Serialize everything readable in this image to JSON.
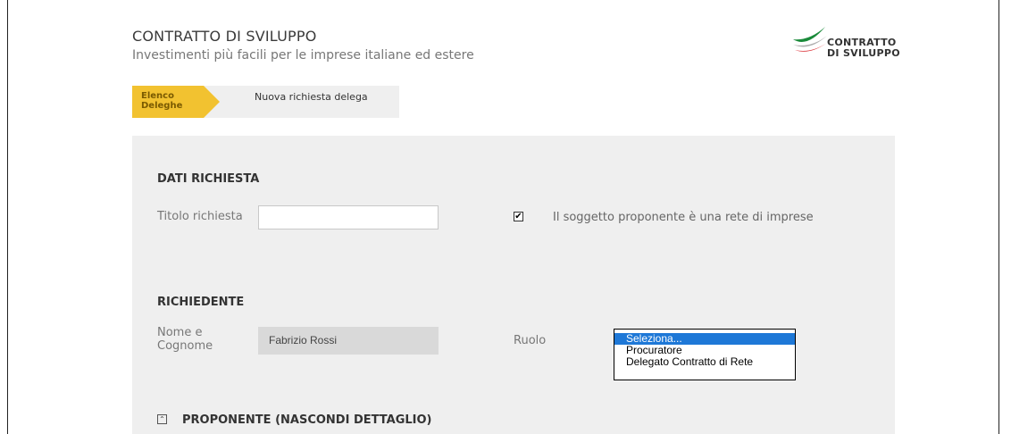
{
  "header": {
    "title": "CONTRATTO DI SVILUPPO",
    "subtitle": "Investimenti più facili per le imprese italiane ed estere",
    "logo_line1": "CONTRATTO",
    "logo_line2": "DI SVILUPPO"
  },
  "breadcrumb": {
    "active_line1": "Elenco",
    "active_line2": "Deleghe",
    "next": "Nuova richiesta delega"
  },
  "dati_richiesta": {
    "section_title": "DATI RICHIESTA",
    "titolo_label": "Titolo richiesta",
    "titolo_value": "",
    "rete_checked": "✔",
    "rete_label": "Il soggetto proponente è una rete di imprese"
  },
  "richiedente": {
    "section_title": "RICHIEDENTE",
    "nome_label_1": "Nome e",
    "nome_label_2": "Cognome",
    "nome_value": "Fabrizio Rossi",
    "ruolo_label": "Ruolo",
    "ruolo_options": [
      "Seleziona...",
      "Procuratore",
      "Delegato Contratto di Rete"
    ]
  },
  "proponente": {
    "collapse_glyph": "⌃",
    "section_title": "PROPONENTE (NASCONDI DETTAGLIO)"
  },
  "colors": {
    "accent_yellow": "#f2c230",
    "panel_bg": "#efefef",
    "select_highlight": "#1e78d7"
  }
}
